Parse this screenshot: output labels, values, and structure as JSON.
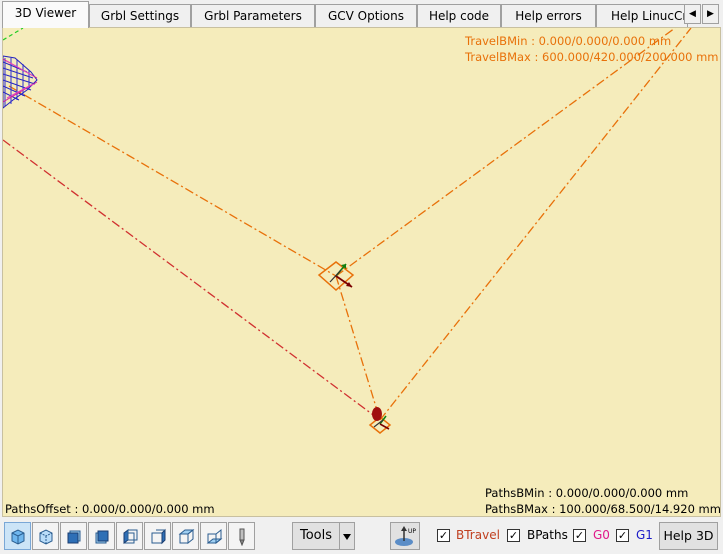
{
  "tabs": [
    {
      "label": "3D Viewer",
      "active": true
    },
    {
      "label": "Grbl Settings",
      "active": false
    },
    {
      "label": "Grbl Parameters",
      "active": false
    },
    {
      "label": "GCV Options",
      "active": false
    },
    {
      "label": "Help code",
      "active": false
    },
    {
      "label": "Help errors",
      "active": false
    },
    {
      "label": "Help LinucCr",
      "active": false
    }
  ],
  "tab_nav": {
    "left": "◀",
    "right": "▶"
  },
  "viewer": {
    "travel_bmin": "TravelBMin : 0.000/0.000/0.000 mm",
    "travel_bmax": "TravelBMax : 600.000/420.000/200.000 mm",
    "paths_offset": "PathsOffset : 0.000/0.000/0.000 mm",
    "paths_bmin": "PathsBMin : 0.000/0.000/0.000 mm",
    "paths_bmax": "PathsBMax : 100.000/68.500/14.920 mm",
    "colors": {
      "background": "#f5ecbb",
      "travel_box": "#e8710a",
      "g0_path": "#d03030",
      "axis_x": "#c00000",
      "axis_y": "#108010",
      "toolpath": "#2020c0"
    }
  },
  "toolbar": {
    "view_buttons": [
      "iso-view-icon",
      "iso-view-alt-icon",
      "front-view-icon",
      "back-view-icon",
      "left-view-icon",
      "right-view-icon",
      "top-view-icon",
      "bottom-view-icon",
      "tool-icon"
    ],
    "tools_label": "Tools",
    "up_label": "UP",
    "checks": [
      {
        "label": "BTravel",
        "checked": true,
        "color": "#c04020"
      },
      {
        "label": "BPaths",
        "checked": true,
        "color": "#000000"
      },
      {
        "label": "G0",
        "checked": true,
        "color": "#e0188a"
      },
      {
        "label": "G1",
        "checked": true,
        "color": "#1a1ac8"
      }
    ],
    "check_mark": "✓",
    "help3d_label": "Help 3D"
  }
}
